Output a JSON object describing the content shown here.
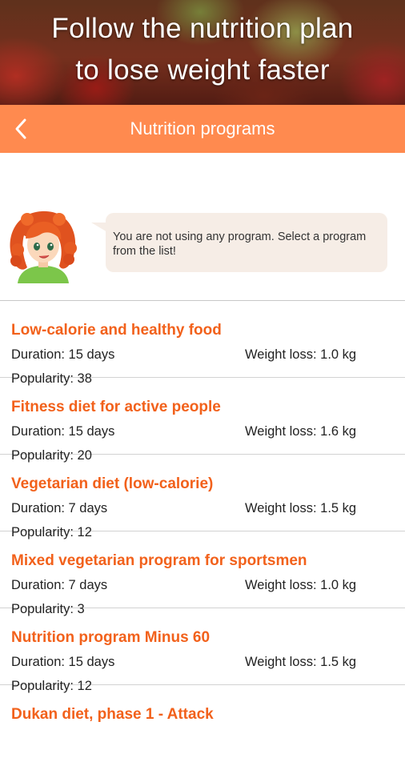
{
  "banner": {
    "line1": "Follow the nutrition plan",
    "line2": "to lose weight faster"
  },
  "toolbar": {
    "title": "Nutrition programs",
    "back_icon": "chevron-left-icon",
    "color": "#ff8a4f"
  },
  "assistant": {
    "message": "You are not using any program. Select a program from the list!"
  },
  "accent_color": "#f2611b",
  "programs": [
    {
      "name": "Low-calorie and healthy food",
      "duration": "Duration: 15 days",
      "weight_loss": "Weight loss: 1.0 kg",
      "popularity": "Popularity: 38"
    },
    {
      "name": "Fitness diet for active people",
      "duration": "Duration: 15 days",
      "weight_loss": "Weight loss: 1.6 kg",
      "popularity": "Popularity: 20"
    },
    {
      "name": "Vegetarian diet (low-calorie)",
      "duration": "Duration: 7 days",
      "weight_loss": "Weight loss: 1.5 kg",
      "popularity": "Popularity: 12"
    },
    {
      "name": "Mixed vegetarian program for sportsmen",
      "duration": "Duration: 7 days",
      "weight_loss": "Weight loss: 1.0 kg",
      "popularity": "Popularity: 3"
    },
    {
      "name": "Nutrition program Minus 60",
      "duration": "Duration: 15 days",
      "weight_loss": "Weight loss: 1.5 kg",
      "popularity": "Popularity: 12"
    },
    {
      "name": "Dukan diet, phase 1 - Attack"
    }
  ]
}
